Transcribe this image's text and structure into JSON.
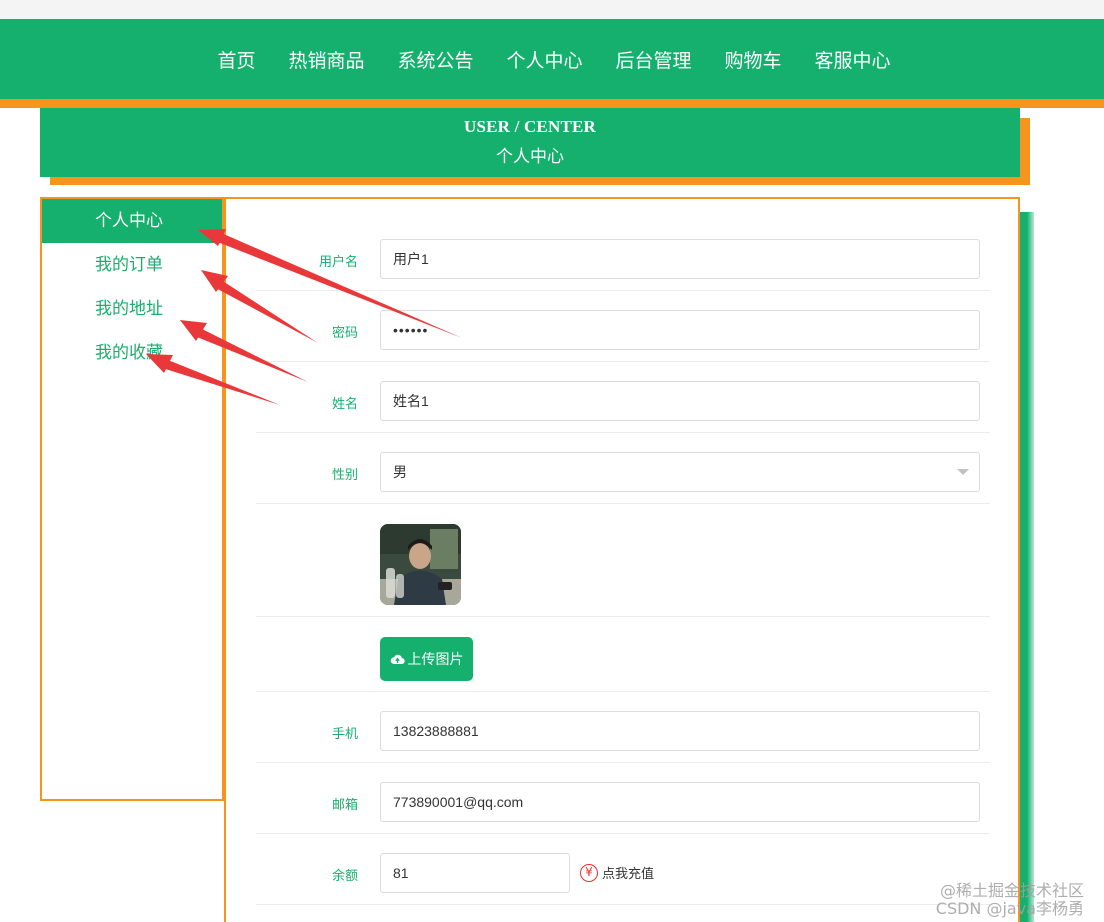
{
  "nav": {
    "items": [
      "首页",
      "热销商品",
      "系统公告",
      "个人中心",
      "后台管理",
      "购物车",
      "客服中心"
    ]
  },
  "banner": {
    "en": "USER / CENTER",
    "cn": "个人中心"
  },
  "sidebar": {
    "items": [
      {
        "label": "个人中心",
        "active": true
      },
      {
        "label": "我的订单",
        "active": false
      },
      {
        "label": "我的地址",
        "active": false
      },
      {
        "label": "我的收藏",
        "active": false
      }
    ]
  },
  "form": {
    "username": {
      "label": "用户名",
      "value": "用户1"
    },
    "password": {
      "label": "密码",
      "value": "••••••"
    },
    "name": {
      "label": "姓名",
      "value": "姓名1"
    },
    "gender": {
      "label": "性别",
      "value": "男"
    },
    "upload": {
      "label": "上传图片",
      "icon": "cloud-upload-icon"
    },
    "phone": {
      "label": "手机",
      "value": "13823888881"
    },
    "email": {
      "label": "邮箱",
      "value": "773890001@qq.com"
    },
    "balance": {
      "label": "余额",
      "value": "81",
      "recharge": "点我充值",
      "recharge_icon": "yen-icon"
    }
  },
  "watermark": {
    "line1": "@稀土掘金技术社区",
    "line2": "CSDN @java李杨勇"
  },
  "colors": {
    "primary": "#15b06d",
    "accent": "#f7941d",
    "arrow": "#e9302f"
  }
}
